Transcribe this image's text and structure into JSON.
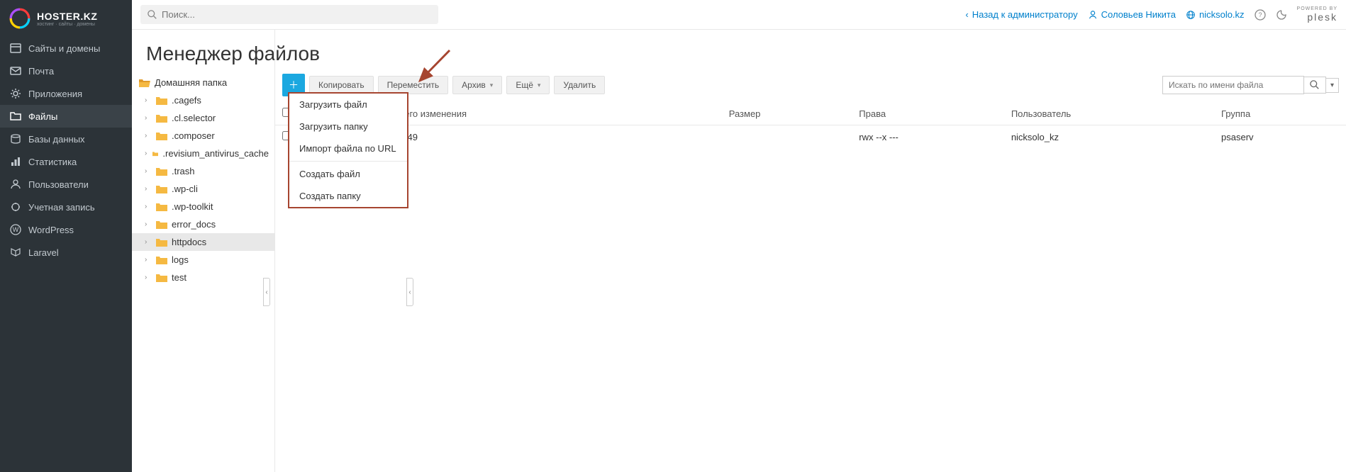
{
  "logo": {
    "name": "HOSTER.KZ",
    "tagline": "хостинг · сайты · домены"
  },
  "nav": [
    {
      "label": "Сайты и домены",
      "icon": "window"
    },
    {
      "label": "Почта",
      "icon": "mail"
    },
    {
      "label": "Приложения",
      "icon": "gear"
    },
    {
      "label": "Файлы",
      "icon": "folder",
      "active": true
    },
    {
      "label": "Базы данных",
      "icon": "db"
    },
    {
      "label": "Статистика",
      "icon": "stats"
    },
    {
      "label": "Пользователи",
      "icon": "users"
    },
    {
      "label": "Учетная запись",
      "icon": "account"
    },
    {
      "label": "WordPress",
      "icon": "wp"
    },
    {
      "label": "Laravel",
      "icon": "laravel"
    }
  ],
  "topbar": {
    "search_placeholder": "Поиск...",
    "back_admin": "Назад к администратору",
    "user_name": "Соловьев Никита",
    "domain": "nicksolo.kz",
    "plesk_powered": "POWERED BY",
    "plesk": "plesk"
  },
  "page_title": "Менеджер файлов",
  "tree": {
    "root": "Домашняя папка",
    "items": [
      ".cagefs",
      ".cl.selector",
      ".composer",
      ".revisium_antivirus_cache",
      ".trash",
      ".wp-cli",
      ".wp-toolkit",
      "error_docs",
      "httpdocs",
      "logs",
      "test"
    ],
    "selected": "httpdocs"
  },
  "toolbar": {
    "copy": "Копировать",
    "move": "Переместить",
    "archive": "Архив",
    "more": "Ещё",
    "delete": "Удалить",
    "search_placeholder": "Искать по имени файла"
  },
  "dropdown": {
    "upload_file": "Загрузить файл",
    "upload_folder": "Загрузить папку",
    "import_url": "Импорт файла по URL",
    "create_file": "Создать файл",
    "create_folder": "Создать папку"
  },
  "table": {
    "headers": {
      "modified": "Дата последнего изменения",
      "size": "Размер",
      "perms": "Права",
      "user": "Пользователь",
      "group": "Группа"
    },
    "row": {
      "modified": "23/02/2024 01:49",
      "size": "",
      "perms": "rwx --x ---",
      "user": "nicksolo_kz",
      "group": "psaserv"
    }
  }
}
